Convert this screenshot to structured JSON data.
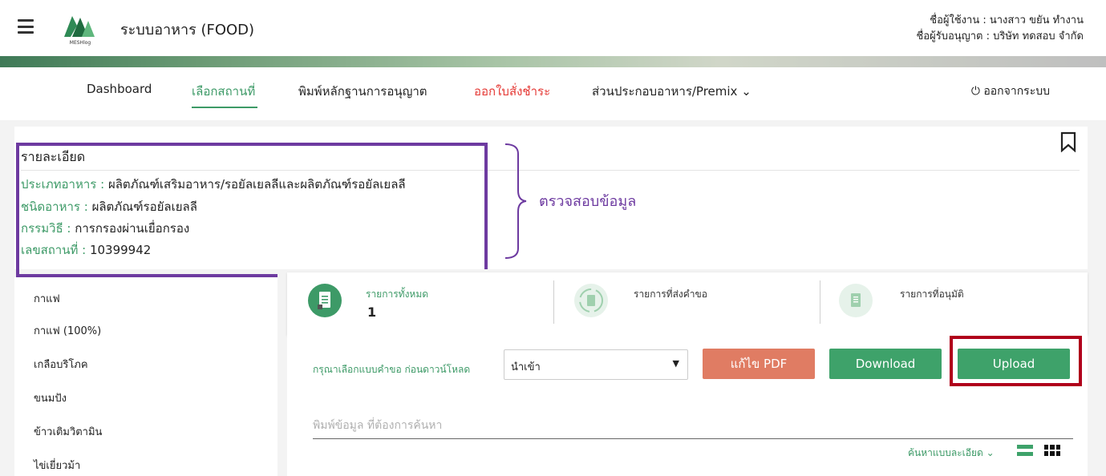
{
  "header": {
    "app_title": "ระบบอาหาร (FOOD)",
    "logo_text": "MESHlog",
    "user_line": "ชื่อผู้ใช้งาน : นางสาว ขยัน ทำงาน",
    "licensee_line": "ชื่อผู้รับอนุญาต : บริษัท ทดสอบ จำกัด"
  },
  "nav": {
    "items": [
      {
        "label": "Dashboard"
      },
      {
        "label": "เลือกสถานที่"
      },
      {
        "label": "พิมพ์หลักฐานการอนุญาต"
      },
      {
        "label": "ออกใบสั่งชำระ"
      },
      {
        "label": "ส่วนประกอบอาหาร/Premix ⌄"
      }
    ],
    "logout_label": "ออกจากระบบ",
    "active_color": "#3d9a67",
    "alert_color": "#e53935"
  },
  "detail": {
    "title": "รายละเอียด",
    "rows": [
      {
        "key": "ประเภทอาหาร : ",
        "value": "ผลิตภัณฑ์เสริมอาหาร/รอยัลเยลลีและผลิตภัณฑ์รอยัลเยลลี"
      },
      {
        "key": "ชนิดอาหาร : ",
        "value": "ผลิตภัณฑ์รอยัลเยลลี"
      },
      {
        "key": "กรรมวิธี : ",
        "value": "การกรองผ่านเยื่อกรอง"
      },
      {
        "key": "เลขสถานที่ : ",
        "value": "10399942"
      }
    ],
    "annotation": "ตรวจสอบข้อมูล"
  },
  "sidebar": {
    "items": [
      {
        "label": "กาแฟ"
      },
      {
        "label": "กาแฟ (100%)"
      },
      {
        "label": "เกลือบริโภค"
      },
      {
        "label": "ขนมปัง"
      },
      {
        "label": "ข้าวเติมวิตามิน"
      },
      {
        "label": "ไข่เยี่ยวม้า"
      }
    ]
  },
  "stats": [
    {
      "label": "รายการทั้งหมด",
      "value": "1",
      "icon": "document-icon"
    },
    {
      "label": "รายการที่ส่งคำขอ",
      "value": "",
      "icon": "refresh-document-icon"
    },
    {
      "label": "รายการที่อนุมัติ",
      "value": "",
      "icon": "approved-document-icon"
    }
  ],
  "toolbar": {
    "select_label": "กรุณาเลือกแบบคำขอ ก่อนดาวน์โหลด",
    "select_value": "นำเข้า",
    "pdf_button": "แก้ไข PDF",
    "download_button": "Download",
    "upload_button": "Upload"
  },
  "search": {
    "placeholder": "พิมพ์ข้อมูล ที่ต้องการค้นหา",
    "advanced_label": "ค้นหาแบบละเอียด ⌄"
  }
}
